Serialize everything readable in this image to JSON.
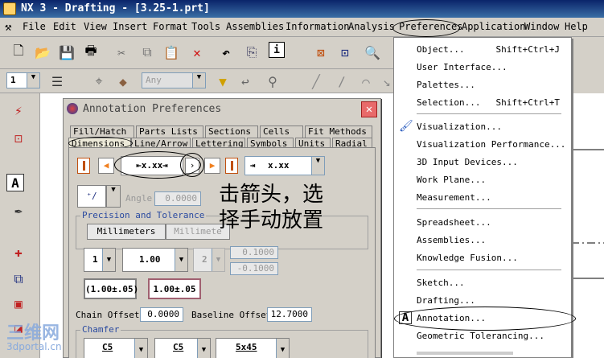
{
  "window": {
    "title": "NX 3 - Drafting - [3.25-1.prt]"
  },
  "menubar": {
    "items": [
      {
        "label": "File"
      },
      {
        "label": "Edit"
      },
      {
        "label": "View"
      },
      {
        "label": "Insert"
      },
      {
        "label": "Format"
      },
      {
        "label": "Tools"
      },
      {
        "label": "Assemblies"
      },
      {
        "label": "Information"
      },
      {
        "label": "Analysis"
      },
      {
        "label": "Preferences"
      },
      {
        "label": "Application"
      },
      {
        "label": "Window"
      },
      {
        "label": "Help"
      }
    ]
  },
  "toolbar2": {
    "layer_value": "1",
    "filter_value": "Any"
  },
  "dialog": {
    "title": "Annotation Preferences",
    "tabs_row1": [
      "Fill/Hatch",
      "Parts Lists",
      "Sections",
      "Cells",
      "Fit Methods"
    ],
    "tabs_row2": [
      "Dimensions",
      "Line/Arrow",
      "Lettering",
      "Symbols",
      "Units",
      "Radial"
    ],
    "angle_label": "Angle",
    "angle_value": "0.0000",
    "placement_value": "x.xx",
    "precision_label": "Precision and Tolerance",
    "unit_button_1": "Millimeters",
    "unit_button_2": "Millimete",
    "precision_value": "1",
    "nominal_value": "1.00",
    "tol_precision_value": "2",
    "upper_tol": "0.1000",
    "lower_tol": "-0.1000",
    "tol_style_1": "(1.00±.05)",
    "tol_style_2": "1.00±.05",
    "chain_offset_label": "Chain Offset",
    "chain_offset_value": "0.0000",
    "baseline_offset_label": "Baseline Offset",
    "baseline_offset_value": "12.7000",
    "chamfer_label": "Chamfer",
    "chamfer_1": "C5",
    "chamfer_2": "C5",
    "chamfer_3": "5x45"
  },
  "annotation_text": {
    "line1": "击箭头，选",
    "line2": "择手动放置"
  },
  "preferences_menu": {
    "items": [
      {
        "label": "Object...",
        "shortcut": "Shift+Ctrl+J"
      },
      {
        "label": "User Interface...",
        "shortcut": ""
      },
      {
        "label": "Palettes...",
        "shortcut": ""
      },
      {
        "label": "Selection...",
        "shortcut": "Shift+Ctrl+T"
      },
      {
        "label": "Visualization...",
        "shortcut": ""
      },
      {
        "label": "Visualization Performance...",
        "shortcut": ""
      },
      {
        "label": "3D Input Devices...",
        "shortcut": ""
      },
      {
        "label": "Work Plane...",
        "shortcut": ""
      },
      {
        "label": "Measurement...",
        "shortcut": ""
      },
      {
        "label": "Spreadsheet...",
        "shortcut": ""
      },
      {
        "label": "Assemblies...",
        "shortcut": ""
      },
      {
        "label": "Knowledge Fusion...",
        "shortcut": ""
      },
      {
        "label": "Sketch...",
        "shortcut": ""
      },
      {
        "label": "Drafting...",
        "shortcut": ""
      },
      {
        "label": "Annotation...",
        "shortcut": ""
      },
      {
        "label": "Geometric Tolerancing...",
        "shortcut": ""
      }
    ]
  },
  "watermark": {
    "text": "三维网",
    "url": "3dportal.cn"
  }
}
